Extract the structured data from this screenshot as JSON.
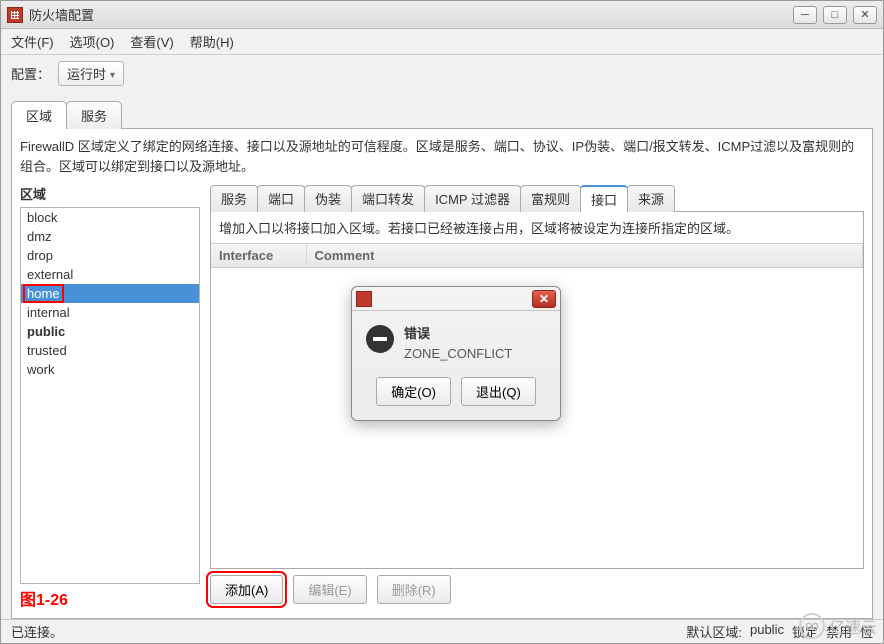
{
  "window": {
    "title": "防火墙配置"
  },
  "menubar": {
    "file": "文件(F)",
    "options": "选项(O)",
    "view": "查看(V)",
    "help": "帮助(H)"
  },
  "config": {
    "label": "配置：",
    "mode": "运行时"
  },
  "outer_tabs": {
    "zones": "区域",
    "services": "服务"
  },
  "description": "FirewallD 区域定义了绑定的网络连接、接口以及源地址的可信程度。区域是服务、端口、协议、IP伪装、端口/报文转发、ICMP过滤以及富规则的组合。区域可以绑定到接口以及源地址。",
  "zone_section": {
    "label": "区域",
    "items": [
      "block",
      "dmz",
      "drop",
      "external",
      "home",
      "internal",
      "public",
      "trusted",
      "work"
    ],
    "selected": "home",
    "bold_item": "public",
    "figure_label": "图1-26"
  },
  "subtabs": {
    "services": "服务",
    "ports": "端口",
    "masq": "伪装",
    "portfwd": "端口转发",
    "icmp": "ICMP 过滤器",
    "richrules": "富规则",
    "interfaces": "接口",
    "sources": "来源"
  },
  "sub_description": "增加入口以将接口加入区域。若接口已经被连接占用，区域将被设定为连接所指定的区域。",
  "table": {
    "columns": {
      "interface": "Interface",
      "comment": "Comment"
    }
  },
  "actions": {
    "add": "添加(A)",
    "edit": "编辑(E)",
    "delete": "删除(R)"
  },
  "dialog": {
    "title": "错误",
    "message": "ZONE_CONFLICT",
    "ok": "确定(O)",
    "quit": "退出(Q)"
  },
  "statusbar": {
    "left": "已连接。",
    "default_zone_label": "默认区域:",
    "default_zone_value": "public",
    "lock": "锁定",
    "disable": "禁用",
    "trailing": "恆"
  },
  "watermark": "亿速云"
}
